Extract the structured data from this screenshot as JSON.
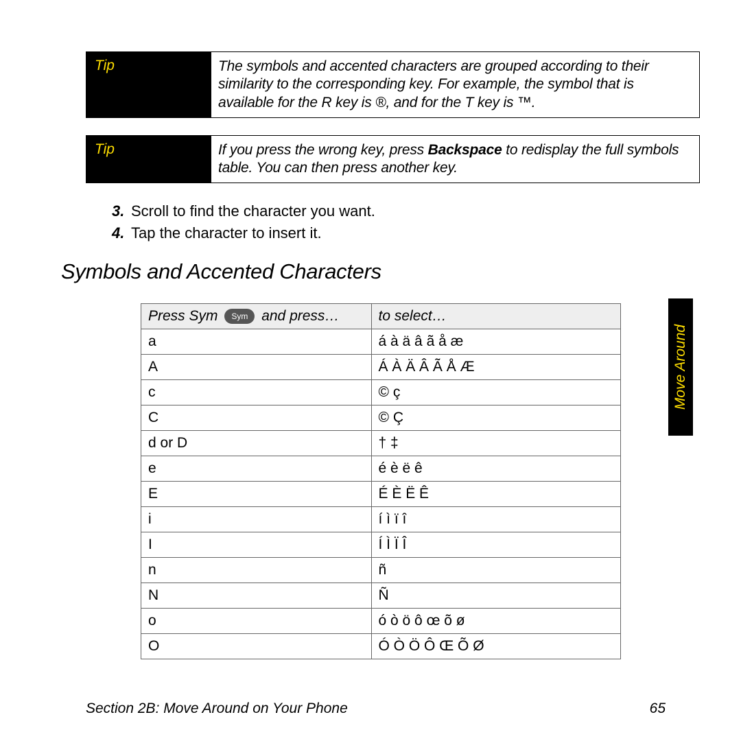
{
  "tips": {
    "tip1": {
      "label": "Tip",
      "text_before": "The symbols and accented characters are grouped according to their similarity to the corresponding key. For example, the symbol that is available for the R key is ®, and for the T key is ™."
    },
    "tip2": {
      "label": "Tip",
      "text_before": "If you press the wrong key, press ",
      "bold": "Backspace",
      "text_after": " to redisplay the full symbols table. You can then press another key."
    }
  },
  "steps": {
    "s3": {
      "num": "3.",
      "text": "Scroll to find the character you want."
    },
    "s4": {
      "num": "4.",
      "text": "Tap the character to insert it."
    }
  },
  "section_title": "Symbols and Accented Characters",
  "table": {
    "head_left_pre": "Press Sym ",
    "sym_key_label": "Sym",
    "head_left_post": " and press…",
    "head_right": "to select…",
    "rows": [
      {
        "k": "a",
        "v": "á à ä â ã å æ"
      },
      {
        "k": "A",
        "v": "Á À Ä Â Ã Å Æ"
      },
      {
        "k": "c",
        "v": "© ç"
      },
      {
        "k": "C",
        "v": "© Ç"
      },
      {
        "k": "d or D",
        "v": "† ‡"
      },
      {
        "k": "e",
        "v": "é è ë ê"
      },
      {
        "k": "E",
        "v": "É È Ë Ê"
      },
      {
        "k": "i",
        "v": "í ì ï î"
      },
      {
        "k": "I",
        "v": "Í Ì Ï Î"
      },
      {
        "k": "n",
        "v": "ñ"
      },
      {
        "k": "N",
        "v": "Ñ"
      },
      {
        "k": "o",
        "v": "ó ò ö ô œ õ ø"
      },
      {
        "k": "O",
        "v": "Ó Ò Ö Ô Œ Õ Ø"
      }
    ]
  },
  "side_tab": "Move Around",
  "footer": {
    "left": "Section 2B: Move Around on Your Phone",
    "right": "65"
  }
}
